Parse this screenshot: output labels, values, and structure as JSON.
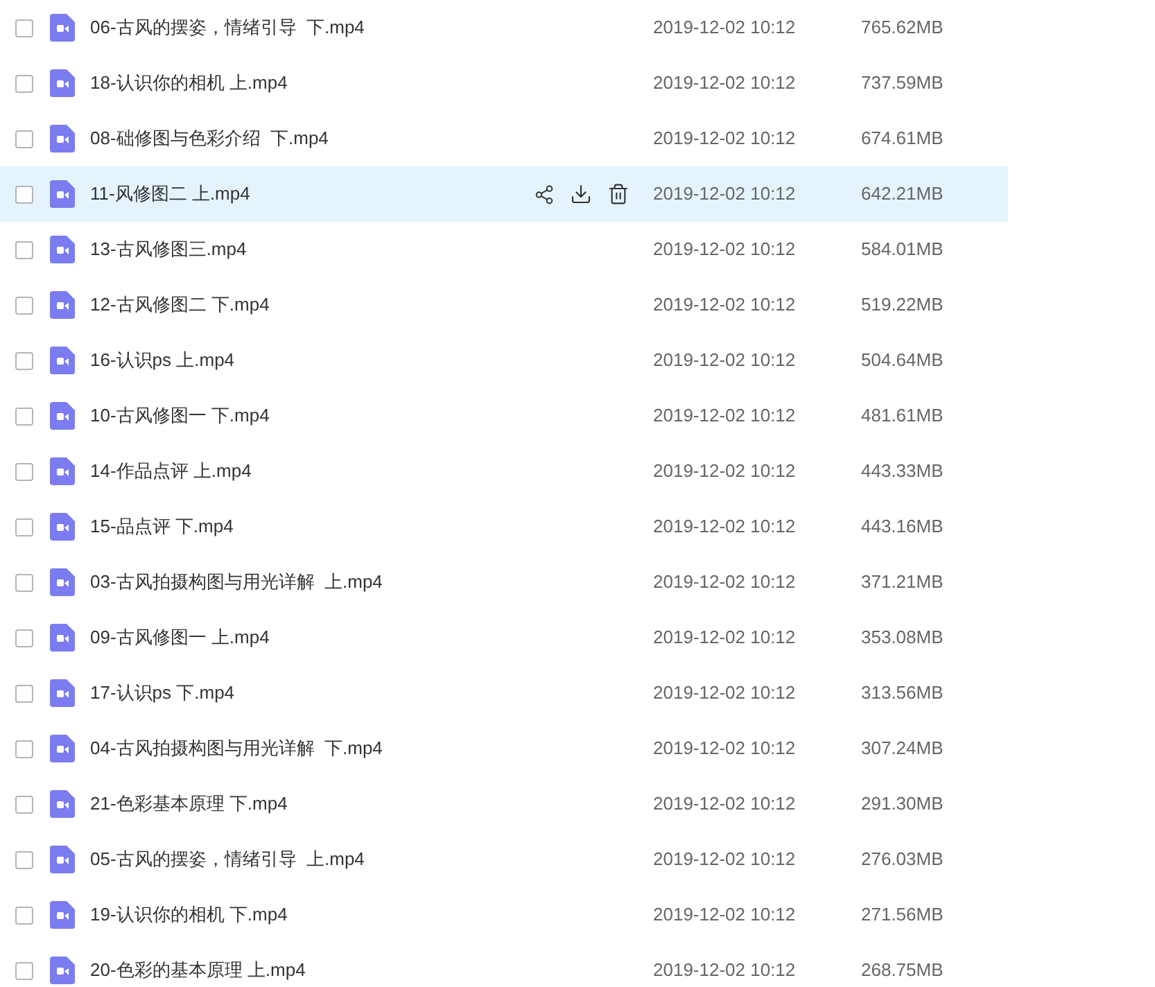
{
  "files": [
    {
      "name": "06-古风的摆姿，情绪引导  下.mp4",
      "date": "2019-12-02 10:12",
      "size": "765.62MB",
      "checked": false,
      "highlighted": false
    },
    {
      "name": "18-认识你的相机 上.mp4",
      "date": "2019-12-02 10:12",
      "size": "737.59MB",
      "checked": false,
      "highlighted": false
    },
    {
      "name": "08-础修图与色彩介绍  下.mp4",
      "date": "2019-12-02 10:12",
      "size": "674.61MB",
      "checked": false,
      "highlighted": false
    },
    {
      "name": "11-风修图二 上.mp4",
      "date": "2019-12-02 10:12",
      "size": "642.21MB",
      "checked": false,
      "highlighted": true
    },
    {
      "name": "13-古风修图三.mp4",
      "date": "2019-12-02 10:12",
      "size": "584.01MB",
      "checked": false,
      "highlighted": false
    },
    {
      "name": "12-古风修图二 下.mp4",
      "date": "2019-12-02 10:12",
      "size": "519.22MB",
      "checked": false,
      "highlighted": false
    },
    {
      "name": "16-认识ps 上.mp4",
      "date": "2019-12-02 10:12",
      "size": "504.64MB",
      "checked": false,
      "highlighted": false
    },
    {
      "name": "10-古风修图一 下.mp4",
      "date": "2019-12-02 10:12",
      "size": "481.61MB",
      "checked": false,
      "highlighted": false
    },
    {
      "name": "14-作品点评 上.mp4",
      "date": "2019-12-02 10:12",
      "size": "443.33MB",
      "checked": false,
      "highlighted": false
    },
    {
      "name": "15-品点评 下.mp4",
      "date": "2019-12-02 10:12",
      "size": "443.16MB",
      "checked": false,
      "highlighted": false
    },
    {
      "name": "03-古风拍摄构图与用光详解  上.mp4",
      "date": "2019-12-02 10:12",
      "size": "371.21MB",
      "checked": false,
      "highlighted": false
    },
    {
      "name": "09-古风修图一 上.mp4",
      "date": "2019-12-02 10:12",
      "size": "353.08MB",
      "checked": false,
      "highlighted": false
    },
    {
      "name": "17-认识ps 下.mp4",
      "date": "2019-12-02 10:12",
      "size": "313.56MB",
      "checked": false,
      "highlighted": false
    },
    {
      "name": "04-古风拍摄构图与用光详解  下.mp4",
      "date": "2019-12-02 10:12",
      "size": "307.24MB",
      "checked": false,
      "highlighted": false
    },
    {
      "name": "21-色彩基本原理 下.mp4",
      "date": "2019-12-02 10:12",
      "size": "291.30MB",
      "checked": false,
      "highlighted": false
    },
    {
      "name": "05-古风的摆姿，情绪引导  上.mp4",
      "date": "2019-12-02 10:12",
      "size": "276.03MB",
      "checked": false,
      "highlighted": false
    },
    {
      "name": "19-认识你的相机 下.mp4",
      "date": "2019-12-02 10:12",
      "size": "271.56MB",
      "checked": false,
      "highlighted": false
    },
    {
      "name": "20-色彩的基本原理 上.mp4",
      "date": "2019-12-02 10:12",
      "size": "268.75MB",
      "checked": false,
      "highlighted": false
    }
  ]
}
